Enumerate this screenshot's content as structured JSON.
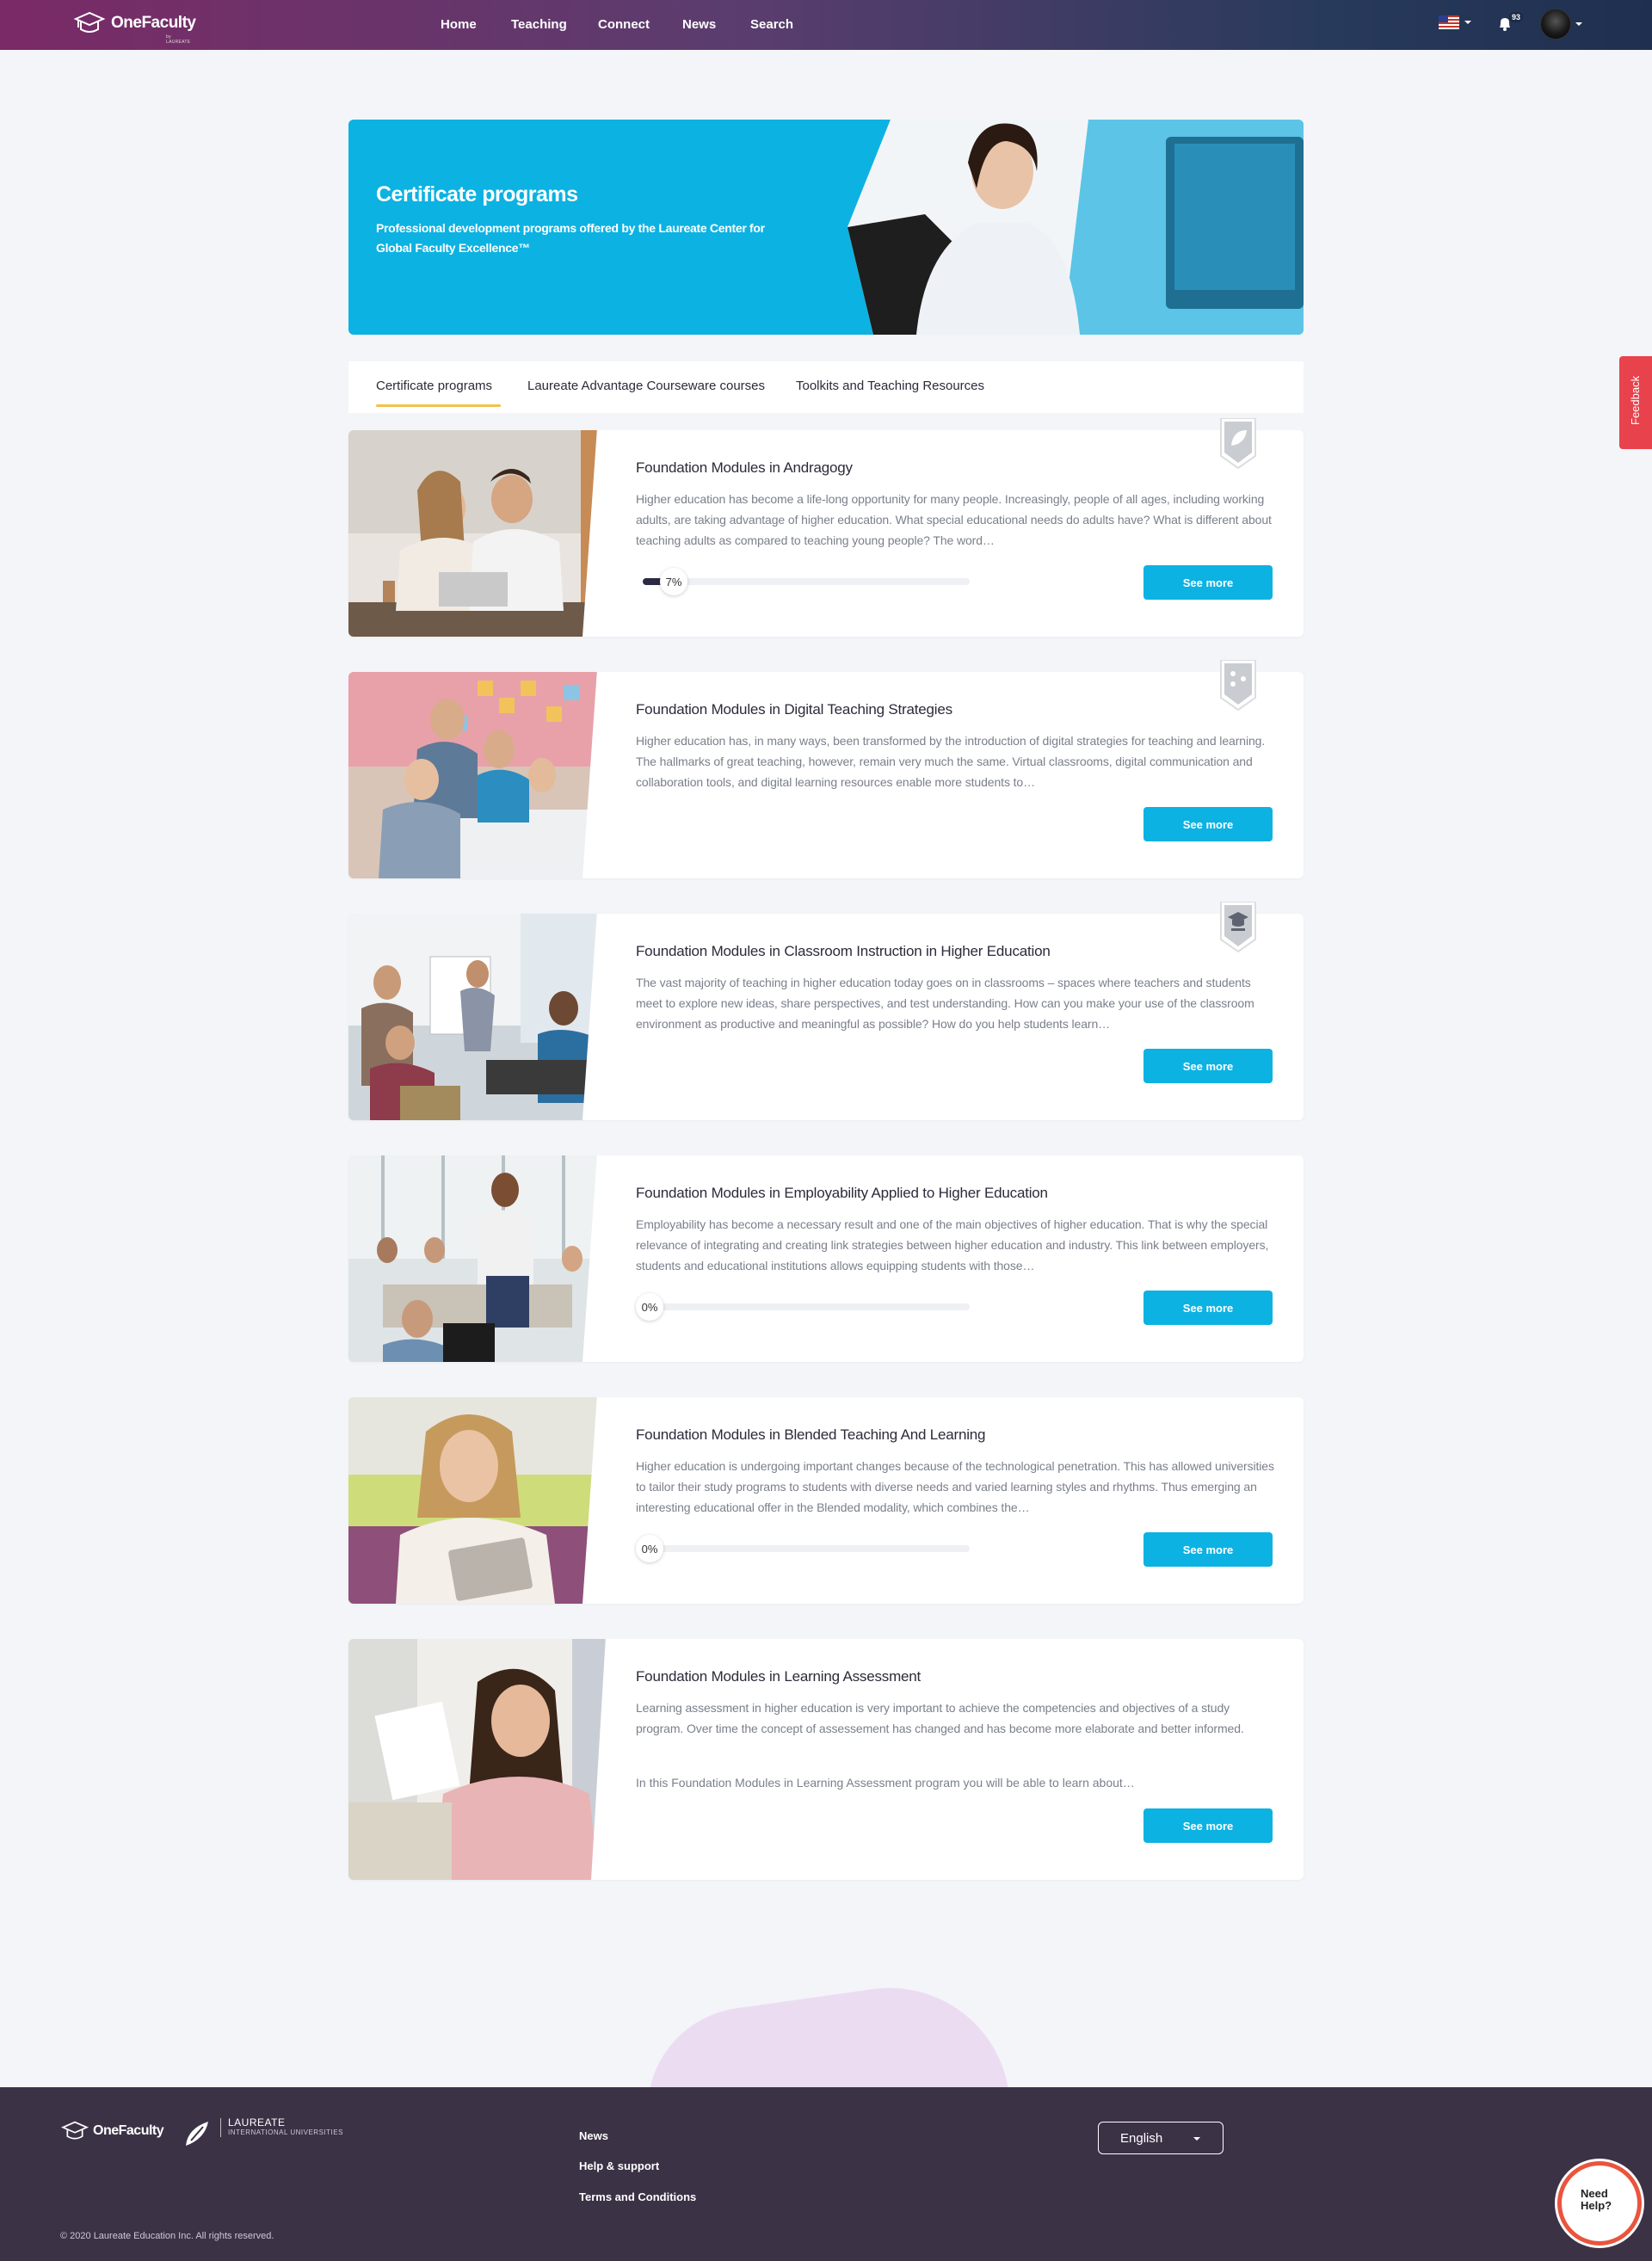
{
  "nav": {
    "brand": "OneFaculty",
    "brand_sub": "by LAUREATE",
    "links": [
      "Home",
      "Teaching",
      "Connect",
      "News",
      "Search"
    ],
    "notifications_count": "93"
  },
  "hero": {
    "title": "Certificate programs",
    "subtitle": "Professional development programs offered by the Laureate Center for Global Faculty Excellence™"
  },
  "tabs": [
    "Certificate programs",
    "Laureate Advantage Courseware courses",
    "Toolkits and Teaching Resources"
  ],
  "cards": [
    {
      "title": "Foundation Modules in Andragogy",
      "description": "Higher education has become a life-long opportunity for many people. Increasingly, people of all ages, including working adults, are taking advantage of higher education. What special educational needs do adults have? What is different about teaching adults as compared to teaching young people? The word…",
      "progress_label": "7%",
      "progress": 0.07,
      "button": "See more"
    },
    {
      "title": "Foundation Modules in Digital Teaching Strategies",
      "description": "Higher education has, in many ways, been transformed by the introduction of digital strategies for teaching and learning. The hallmarks of great teaching, however, remain very much the same. Virtual classrooms, digital communication and collaboration tools, and digital learning resources enable more students to…",
      "button": "See more"
    },
    {
      "title": "Foundation Modules in Classroom Instruction in Higher Education",
      "description": "The vast majority of teaching in higher education today goes on in classrooms – spaces where teachers and students meet to explore new ideas, share perspectives, and test understanding. How can you make your use of the classroom environment as productive and meaningful as possible? How do you help students learn…",
      "button": "See more"
    },
    {
      "title": "Foundation Modules in Employability Applied to Higher Education",
      "description": "Employability has become a necessary result and one of the main objectives of higher education. That is why the special relevance of integrating and creating link strategies between higher education and industry. This link between employers, students and educational institutions allows equipping students with those…",
      "progress_label": "0%",
      "progress": 0,
      "button": "See more"
    },
    {
      "title": "Foundation Modules in Blended Teaching And Learning",
      "description": "Higher education is undergoing important changes because of the technological penetration. This has allowed universities to tailor their study programs to students with diverse needs and varied learning styles and rhythms. Thus emerging an interesting educational offer in the Blended modality, which combines the…",
      "progress_label": "0%",
      "progress": 0,
      "button": "See more"
    },
    {
      "title": "Foundation Modules in Learning Assessment",
      "description": "Learning assessment in higher education is very important to achieve the competencies and objectives of a study program. Over time the concept of assessement has changed and has become more elaborate and better informed.",
      "description2": "In this Foundation Modules in Learning Assessment program you will be able to learn about…",
      "button": "See more"
    }
  ],
  "feedback": "Feedback",
  "footer": {
    "brand": "OneFaculty",
    "laureate": "LAUREATE",
    "laureate_sub": "INTERNATIONAL UNIVERSITIES",
    "links": [
      "News",
      "Help & support",
      "Terms and Conditions"
    ],
    "language": "English",
    "copyright": "© 2020 Laureate Education Inc. All rights reserved."
  },
  "need_help": "Need Help?",
  "colors": {
    "accent": "#0cb2e2",
    "tab_underline": "#f5c04a",
    "footer_bg": "#3c3246",
    "feedback": "#e8424d"
  }
}
